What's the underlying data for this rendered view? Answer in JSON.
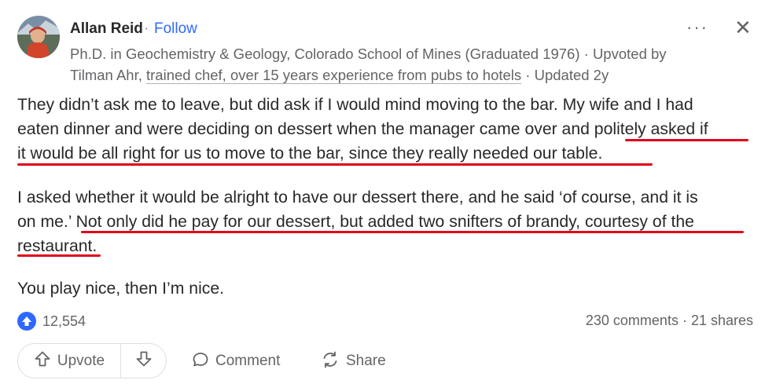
{
  "post": {
    "author": "Allan Reid",
    "separator": "·",
    "follow_label": "Follow",
    "credential_line1": "Ph.D. in Geochemistry & Geology, Colorado School of Mines (Graduated 1976) · Upvoted by",
    "upvoter": "Tilman Ahr,",
    "upvoter_credential": "trained chef, over 15 years experience from pubs to hotels",
    "updated": "· Updated 2y",
    "more_icon": "···",
    "close_icon": "✕"
  },
  "body": {
    "p1_line1": "They didn’t ask me to leave, but did ask if I would mind moving to the bar. My wife and I had",
    "p1_line2": "eaten dinner and were deciding on dessert when the manager came over and politely asked if",
    "p1_line3": "it would be all right for us to move to the bar, since they really needed our table.",
    "p2_line1": "I asked whether it would be alright to have our dessert there, and he said ‘of course, and it is",
    "p2_line2": "on me.’ Not only did he pay for our dessert, but added two snifters of brandy, courtesy of the",
    "p2_line3": "restaurant.",
    "p3_line1": "You play nice, then I’m nice.",
    "highlight_color": "#e0001a"
  },
  "stats": {
    "upvotes": "12,554",
    "comments_shares": "230 comments · 21 shares"
  },
  "actions": {
    "upvote_label": "Upvote",
    "comment_label": "Comment",
    "share_label": "Share"
  },
  "colors": {
    "accent": "#2e69ff",
    "muted": "#636466"
  }
}
